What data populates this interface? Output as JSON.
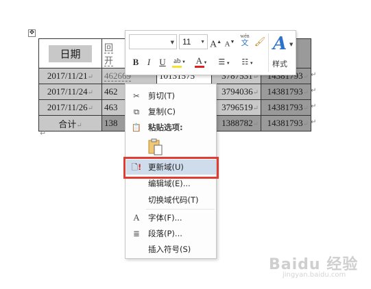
{
  "table": {
    "header": {
      "date_label": "日期",
      "col_b": "回",
      "col_b2": "开"
    },
    "rows": [
      {
        "date": "2017/11/21",
        "b": "462669",
        "c": "10131575",
        "d": "3787531",
        "e": "14381793"
      },
      {
        "date": "2017/11/24",
        "b": "462",
        "c": "",
        "d": "3794036",
        "e": "14381793"
      },
      {
        "date": "2017/11/26",
        "b": "463",
        "c": "",
        "d": "3796519",
        "e": "14381793"
      },
      {
        "date": "合计",
        "b": "138",
        "c": "",
        "d": "1388782",
        "e": "14381793"
      }
    ],
    "cell_mark": "↵",
    "paragraph_mark": "↵",
    "move_handle": "✥"
  },
  "toolbar": {
    "font_name": "",
    "font_size": "11",
    "grow_font": "A",
    "shrink_font": "A",
    "phonetic_top": "wén",
    "phonetic_bottom": "文",
    "bold": "B",
    "italic": "I",
    "underline": "U",
    "highlight": "ab",
    "font_color": "A",
    "styles_glyph": "A",
    "styles_label": "样式",
    "colors": {
      "highlight": "#f5e330",
      "font_color": "#e02020",
      "accent": "#2e73c9"
    }
  },
  "context_menu": {
    "items": [
      {
        "label": "剪切(T)",
        "icon": "scissors-icon"
      },
      {
        "label": "复制(C)",
        "icon": "copy-icon"
      },
      {
        "label": "粘贴选项:",
        "icon": "paste-icon"
      },
      {
        "label": "更新域(U)",
        "icon": "update-field-icon"
      },
      {
        "label": "编辑域(E)...",
        "icon": ""
      },
      {
        "label": "切换域代码(T)",
        "icon": ""
      },
      {
        "label": "字体(F)...",
        "icon": "font-icon"
      },
      {
        "label": "段落(P)...",
        "icon": "paragraph-icon"
      },
      {
        "label": "插入符号(S)",
        "icon": ""
      }
    ],
    "highlight_color": "#cfdcec",
    "callout_color": "#e03c31"
  },
  "watermark": {
    "main": "Baidu 经验",
    "sub": "jingyan.baidu.com"
  }
}
